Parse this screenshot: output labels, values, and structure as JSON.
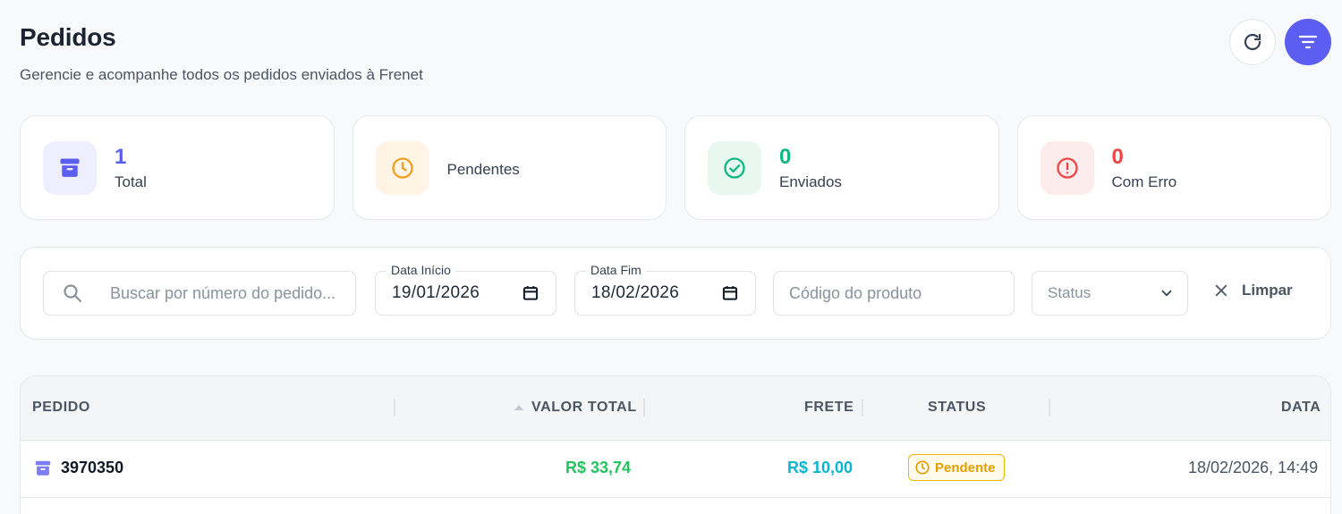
{
  "header": {
    "title": "Pedidos",
    "subtitle": "Gerencie e acompanhe todos os pedidos enviados à Frenet"
  },
  "actions": {
    "refresh_icon": "refresh-icon",
    "filter_icon": "filter-icon",
    "accent": "#5b5ef0"
  },
  "stats": [
    {
      "value": "1",
      "label": "Total",
      "icon": "archive-icon",
      "color": "#5b5ef0",
      "bg": "#eeeefe"
    },
    {
      "value": "",
      "label": "Pendentes",
      "icon": "clock-icon",
      "color": "#f0a020",
      "bg": "#fff4e5"
    },
    {
      "value": "0",
      "label": "Enviados",
      "icon": "check-circle-icon",
      "color": "#10b981",
      "bg": "#e8f8f1"
    },
    {
      "value": "0",
      "label": "Com Erro",
      "icon": "alert-circle-icon",
      "color": "#ef4444",
      "bg": "#fdecec"
    }
  ],
  "filters": {
    "search_placeholder": "Buscar por número do pedido...",
    "start_label": "Data Início",
    "start_value": "19/01/2026",
    "end_label": "Data Fim",
    "end_value": "18/02/2026",
    "code_placeholder": "Código do produto",
    "status_placeholder": "Status",
    "clear_label": "Limpar"
  },
  "table": {
    "columns": [
      "PEDIDO",
      "VALOR TOTAL",
      "FRETE",
      "STATUS",
      "DATA"
    ],
    "rows": [
      {
        "pedido": "3970350",
        "valor_total": "R$ 33,74",
        "frete": "R$ 10,00",
        "status": "Pendente",
        "data": "18/02/2026, 14:49"
      }
    ]
  }
}
